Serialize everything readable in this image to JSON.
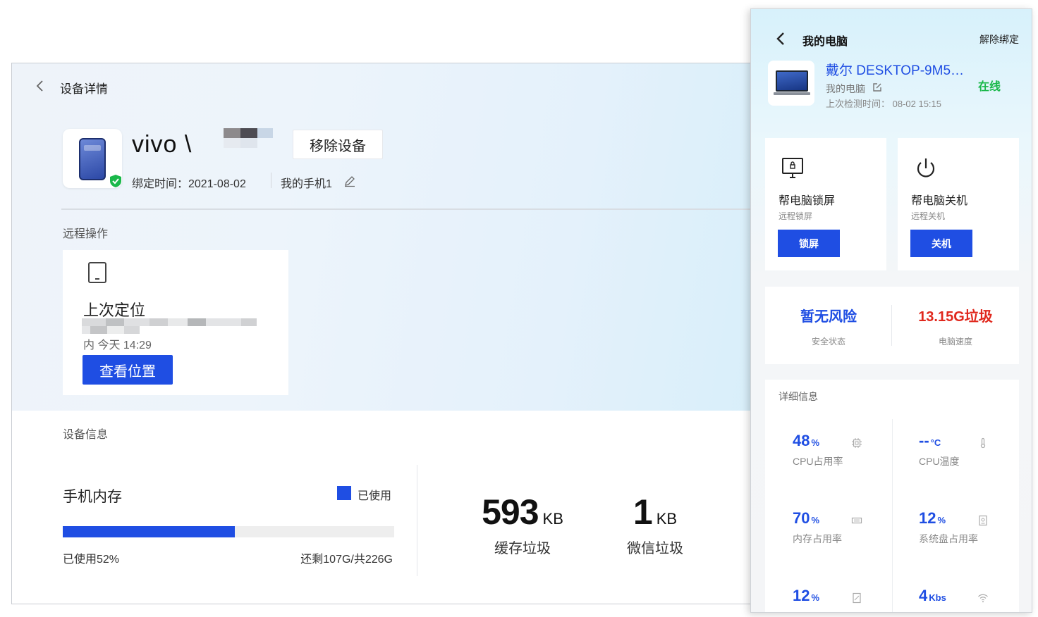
{
  "main": {
    "header": {
      "title": "设备详情"
    },
    "device": {
      "name": "vivo \\",
      "remove_label": "移除设备",
      "bind_time": "绑定时间：2021-08-02",
      "alias": "我的手机1"
    },
    "remote": {
      "section_label": "远程操作",
      "card_title": "上次定位",
      "time_text": "内 今天 14:29",
      "view_button": "查看位置"
    },
    "info": {
      "section_label": "设备信息",
      "storage_title": "手机内存",
      "legend": "已使用",
      "used_percent": 52,
      "used_text": "已使用52%",
      "remaining_text": "还剩107G/共226G",
      "stats": [
        {
          "value": "593",
          "unit": "KB",
          "label": "缓存垃圾"
        },
        {
          "value": "1",
          "unit": "KB",
          "label": "微信垃圾"
        }
      ]
    }
  },
  "panel": {
    "header": {
      "title": "我的电脑",
      "unbind_label": "解除绑定"
    },
    "pc": {
      "name": "戴尔 DESKTOP-9M5…",
      "alias": "我的电脑",
      "last_check": "上次检测时间： 08-02 15:15",
      "status": "在线"
    },
    "actions": [
      {
        "title": "帮电脑锁屏",
        "sub": "远程锁屏",
        "button": "锁屏",
        "icon": "monitor-lock-icon"
      },
      {
        "title": "帮电脑关机",
        "sub": "远程关机",
        "button": "关机",
        "icon": "power-icon"
      }
    ],
    "summary": [
      {
        "value": "暂无风险",
        "label": "安全状态",
        "color": "#1f4ee3"
      },
      {
        "value": "13.15G垃圾",
        "label": "电脑速度",
        "color": "#e0281d"
      }
    ],
    "details": {
      "title": "详细信息",
      "metrics": [
        {
          "value": "48",
          "unit": "%",
          "label": "CPU占用率",
          "icon": "cpu-icon"
        },
        {
          "value": "--",
          "unit": "°C",
          "label": "CPU温度",
          "icon": "thermometer-icon"
        },
        {
          "value": "70",
          "unit": "%",
          "label": "内存占用率",
          "icon": "memory-icon"
        },
        {
          "value": "12",
          "unit": "%",
          "label": "系统盘占用率",
          "icon": "disk-icon"
        },
        {
          "value": "12",
          "unit": "%",
          "label": "",
          "icon": "gpu-icon"
        },
        {
          "value": "4",
          "unit": "Kbs",
          "label": "",
          "icon": "wifi-icon"
        }
      ]
    }
  },
  "colors": {
    "accent": "#1f4ee3",
    "online": "#1ab84a",
    "danger": "#e0281d"
  }
}
